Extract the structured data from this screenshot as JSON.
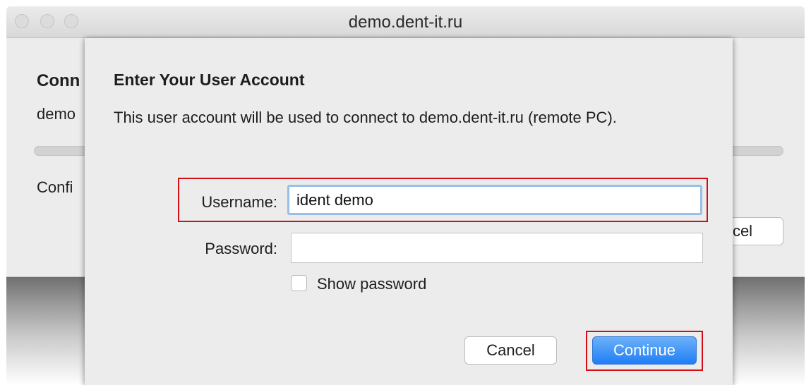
{
  "window": {
    "title": "demo.dent-it.ru"
  },
  "background": {
    "heading_partial": "Conn",
    "host_partial": "demo",
    "status_partial": "Confi",
    "cancel_partial": "cel"
  },
  "sheet": {
    "title": "Enter Your User Account",
    "description": "This user account will be used to connect to demo.dent-it.ru (remote PC).",
    "username_label": "Username:",
    "username_value": "ident demo",
    "password_label": "Password:",
    "password_value": "",
    "show_password_label": "Show password",
    "cancel_label": "Cancel",
    "continue_label": "Continue"
  },
  "colors": {
    "highlight": "#d20f17",
    "accent": "#1f7ef6",
    "focus_ring": "#98bfe9"
  }
}
